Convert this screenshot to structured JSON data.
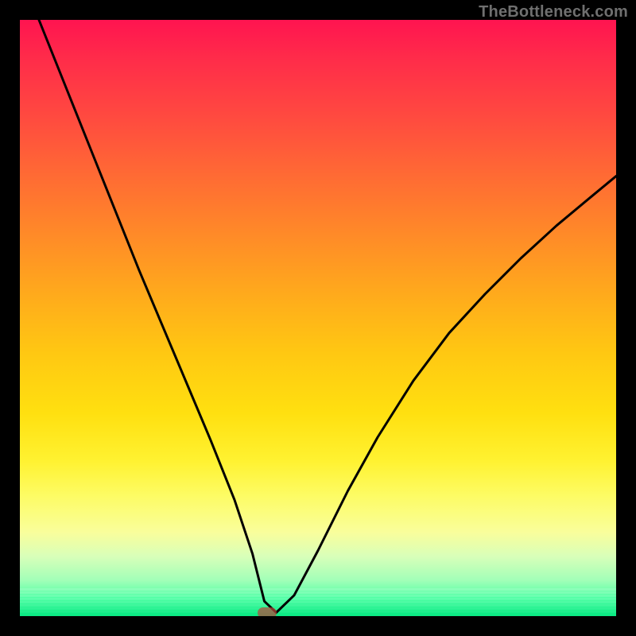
{
  "watermark": {
    "text": "TheBottleneck.com"
  },
  "chart_data": {
    "type": "line",
    "title": "",
    "xlabel": "",
    "ylabel": "",
    "xlim": [
      0,
      100
    ],
    "ylim": [
      0,
      100
    ],
    "grid": false,
    "legend": false,
    "marker": {
      "x": 41.5,
      "y": 0,
      "color": "#b4483c"
    },
    "series": [
      {
        "name": "bottleneck-curve",
        "x": [
          0,
          4,
          8,
          12,
          16,
          20,
          24,
          28,
          32,
          36,
          39,
          41,
          43,
          46,
          50,
          55,
          60,
          66,
          72,
          78,
          84,
          90,
          96,
          100
        ],
        "y": [
          108,
          98,
          88,
          78,
          68,
          58,
          48.5,
          39,
          29.5,
          19.5,
          10.5,
          2.5,
          0.6,
          3.5,
          11,
          21,
          30,
          39.5,
          47.5,
          54,
          60,
          65.5,
          70.5,
          73.8
        ]
      }
    ],
    "background_gradient_stops": [
      {
        "pos": 0.0,
        "color": "#ff1450"
      },
      {
        "pos": 0.46,
        "color": "#ffaa1c"
      },
      {
        "pos": 0.8,
        "color": "#fdfc66"
      },
      {
        "pos": 1.0,
        "color": "#00e97e"
      }
    ],
    "white_band_rows": 9
  }
}
